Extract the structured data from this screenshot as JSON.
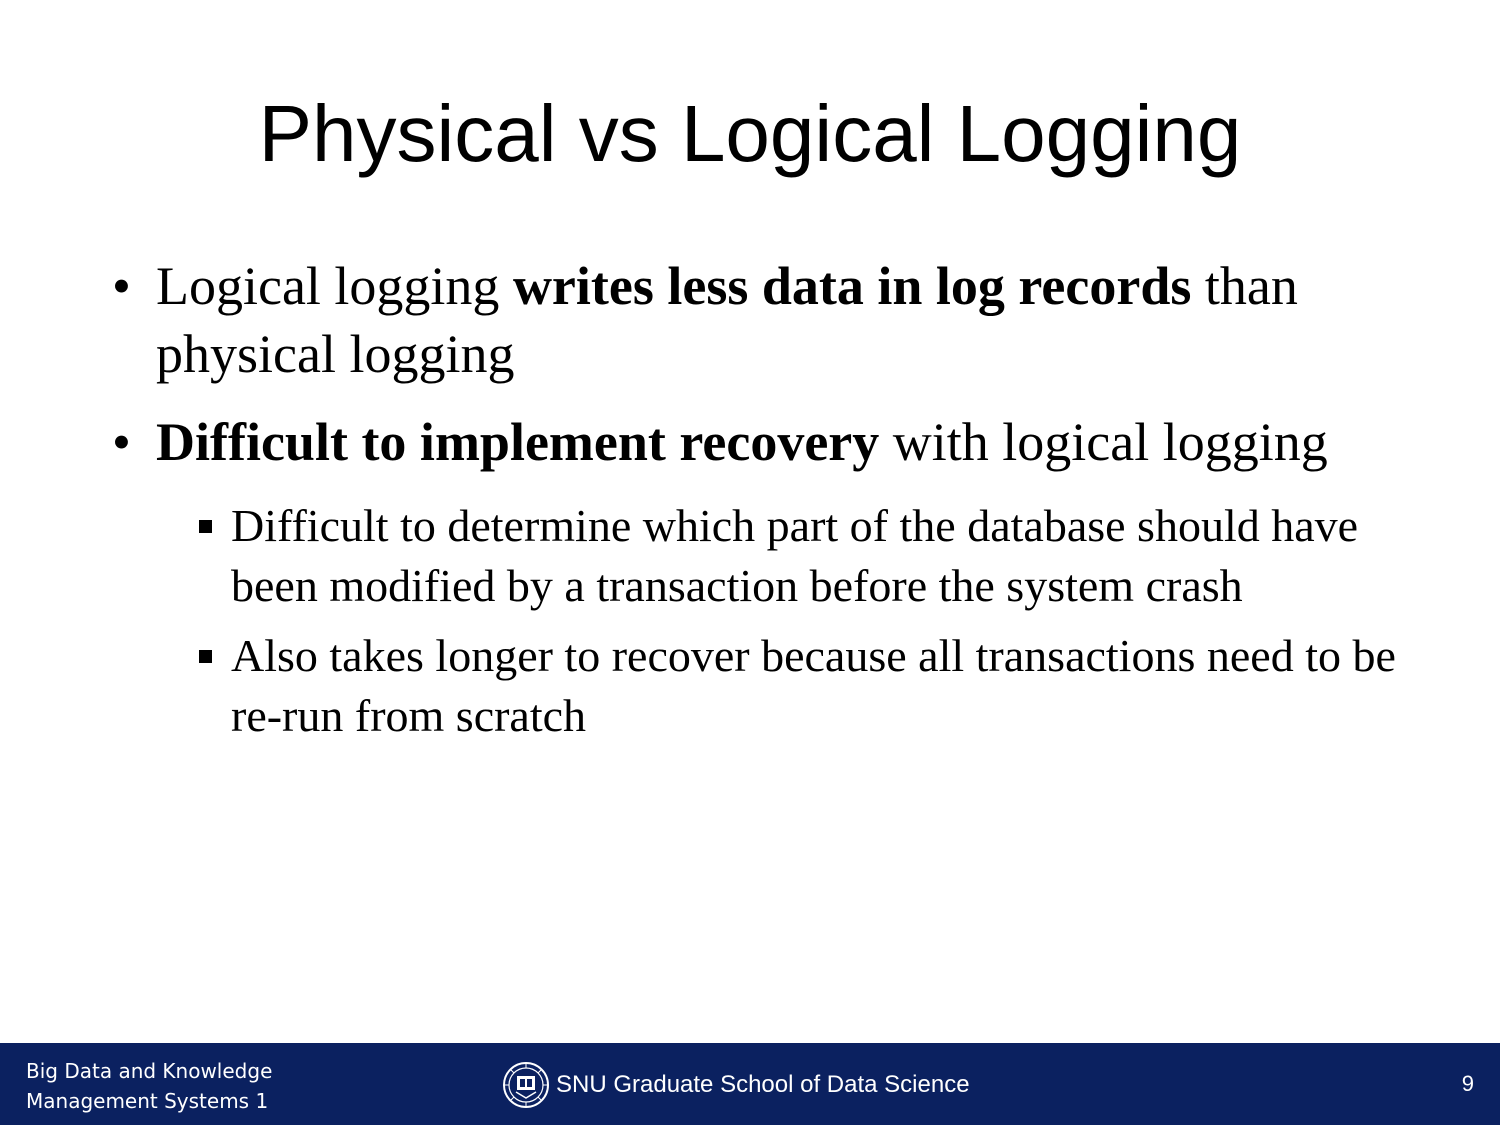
{
  "slide": {
    "title": "Physical vs Logical Logging",
    "bullets": [
      {
        "marker": "•",
        "text_before": "Logical logging ",
        "bold": "writes less data in log records",
        "text_after": " than physical logging"
      },
      {
        "marker": "•",
        "text_before": "",
        "bold": "Difficult to implement recovery",
        "text_after": " with logical logging",
        "sub_bullets": [
          "Difficult to determine which part of the database should have been modified by a transaction before the system crash",
          "Also takes longer to recover because all transactions need to be re-run from scratch"
        ]
      }
    ]
  },
  "footer": {
    "course_line1": "Big Data and Knowledge",
    "course_line2": "Management Systems 1",
    "school_name": "SNU Graduate School of Data Science",
    "logo_icon": "university-seal-icon",
    "page_number": "9",
    "background_color": "#0b2160"
  }
}
